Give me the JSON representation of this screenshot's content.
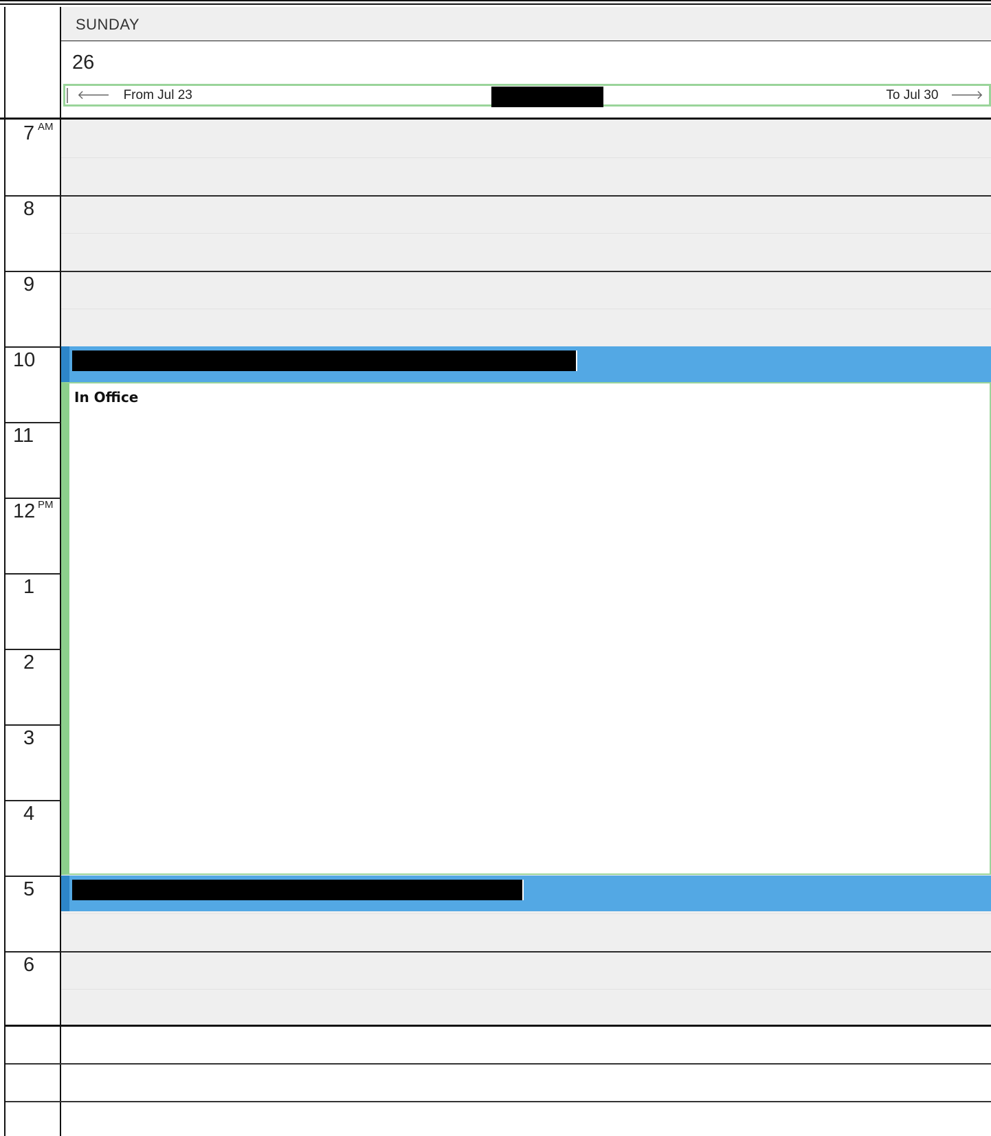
{
  "day": {
    "name": "SUNDAY",
    "number": "26"
  },
  "nav": {
    "prev_label": "From Jul 23",
    "next_label": "To Jul 30",
    "prev_arrow": "🡐",
    "next_arrow": "🡒"
  },
  "hours": [
    {
      "label": "7",
      "suffix": "AM"
    },
    {
      "label": "8",
      "suffix": ""
    },
    {
      "label": "9",
      "suffix": ""
    },
    {
      "label": "10",
      "suffix": ""
    },
    {
      "label": "11",
      "suffix": ""
    },
    {
      "label": "12",
      "suffix": "PM"
    },
    {
      "label": "1",
      "suffix": ""
    },
    {
      "label": "2",
      "suffix": ""
    },
    {
      "label": "3",
      "suffix": ""
    },
    {
      "label": "4",
      "suffix": ""
    },
    {
      "label": "5",
      "suffix": ""
    },
    {
      "label": "6",
      "suffix": ""
    }
  ],
  "events": {
    "in_office": {
      "title": "In Office"
    }
  },
  "colors": {
    "event_blue": "#53a8e4",
    "event_green_border": "#8ccf8c",
    "slot_bg": "#efefef"
  }
}
